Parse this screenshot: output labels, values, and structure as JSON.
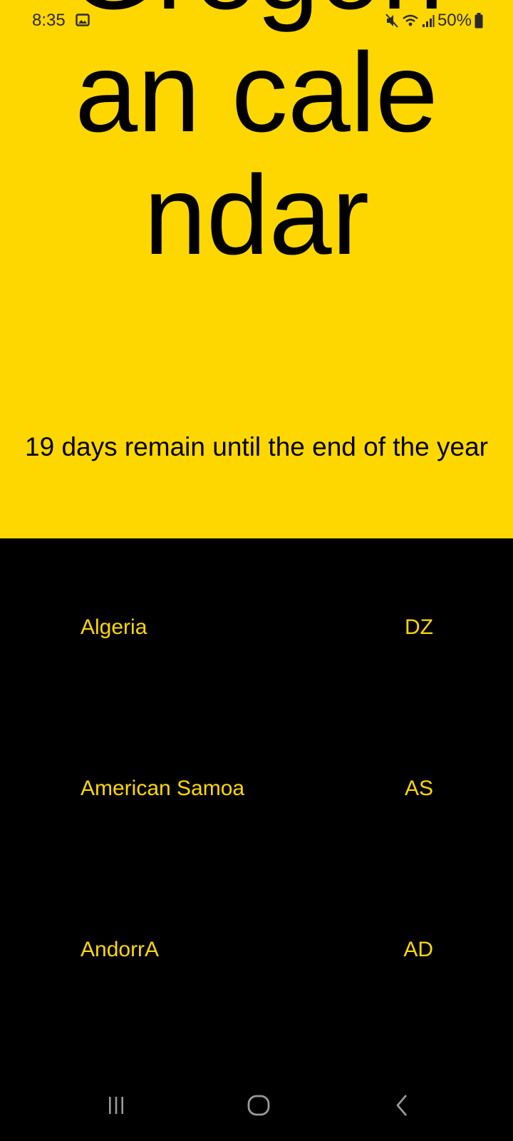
{
  "status_bar": {
    "time": "8:35",
    "battery_text": "50%"
  },
  "hero": {
    "title": "Gregorian calendar",
    "remaining_text": "19 days remain until the end of the year",
    "background_color": "#FFD700"
  },
  "countries": [
    {
      "name": "Algeria",
      "code": "DZ"
    },
    {
      "name": "American Samoa",
      "code": "AS"
    },
    {
      "name": "AndorrA",
      "code": "AD"
    }
  ],
  "colors": {
    "accent": "#FFD700",
    "list_background": "#000000"
  },
  "nav_bar": {
    "icons": [
      "recent-apps-icon",
      "home-icon",
      "back-icon"
    ]
  }
}
